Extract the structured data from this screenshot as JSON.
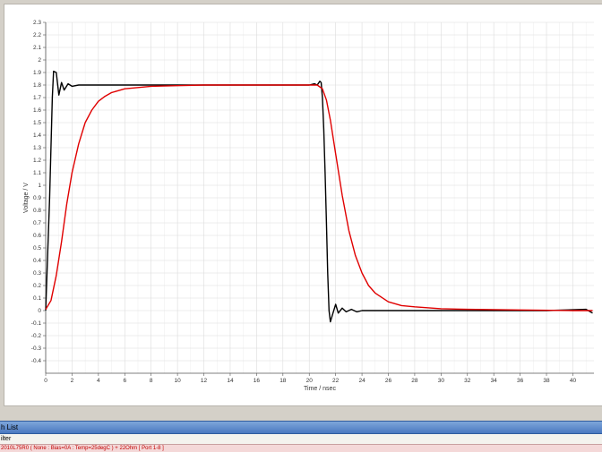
{
  "chart_data": {
    "type": "line",
    "xlabel": "Time / nsec",
    "ylabel": "Voltage / V",
    "xlim": [
      0,
      41.6
    ],
    "ylim": [
      -0.5,
      2.3
    ],
    "xticks": [
      0,
      2,
      4,
      6,
      8,
      10,
      12,
      14,
      16,
      18,
      20,
      22,
      24,
      26,
      28,
      30,
      32,
      34,
      36,
      38,
      40
    ],
    "yticks": [
      -0.4,
      -0.3,
      -0.2,
      -0.1,
      0,
      0.1,
      0.2,
      0.3,
      0.4,
      0.5,
      0.6,
      0.7,
      0.8,
      0.9,
      1,
      1.1,
      1.2,
      1.3,
      1.4,
      1.5,
      1.6,
      1.7,
      1.8,
      1.9,
      2,
      2.1,
      2.2,
      2.3
    ],
    "grid": true,
    "series": [
      {
        "color": "#000000",
        "x": [
          0,
          0.3,
          0.5,
          0.6,
          0.8,
          1.0,
          1.2,
          1.4,
          1.7,
          2.0,
          2.5,
          3,
          4,
          6,
          8,
          10,
          12,
          14,
          16,
          18,
          20,
          20.4,
          20.6,
          20.8,
          20.9,
          21.0,
          21.1,
          21.2,
          21.3,
          21.4,
          21.5,
          21.6,
          21.8,
          22.0,
          22.2,
          22.5,
          22.8,
          23.2,
          23.6,
          24,
          25,
          26,
          28,
          30,
          34,
          38,
          41,
          41.5
        ],
        "y": [
          0,
          0.9,
          1.7,
          1.91,
          1.9,
          1.72,
          1.82,
          1.76,
          1.81,
          1.79,
          1.8,
          1.8,
          1.8,
          1.8,
          1.8,
          1.8,
          1.8,
          1.8,
          1.8,
          1.8,
          1.8,
          1.81,
          1.8,
          1.83,
          1.82,
          1.7,
          1.45,
          1.1,
          0.7,
          0.3,
          0.0,
          -0.09,
          -0.02,
          0.05,
          -0.02,
          0.02,
          -0.01,
          0.01,
          -0.01,
          0.0,
          0.0,
          0.0,
          0.0,
          0.0,
          0.0,
          0.0,
          0.01,
          -0.02
        ]
      },
      {
        "color": "#e00000",
        "x": [
          0,
          0.4,
          0.8,
          1.2,
          1.6,
          2.0,
          2.5,
          3,
          3.5,
          4,
          4.5,
          5,
          6,
          7,
          8,
          10,
          12,
          16,
          20,
          20.6,
          21,
          21.3,
          21.6,
          22,
          22.5,
          23,
          23.5,
          24,
          24.5,
          25,
          26,
          27,
          28,
          30,
          32,
          36,
          40,
          41.5
        ],
        "y": [
          0.01,
          0.08,
          0.28,
          0.55,
          0.85,
          1.1,
          1.33,
          1.5,
          1.6,
          1.67,
          1.71,
          1.74,
          1.77,
          1.78,
          1.79,
          1.795,
          1.8,
          1.8,
          1.8,
          1.8,
          1.77,
          1.68,
          1.52,
          1.25,
          0.92,
          0.64,
          0.44,
          0.3,
          0.2,
          0.14,
          0.07,
          0.04,
          0.03,
          0.015,
          0.01,
          0.005,
          0.0,
          0.0
        ]
      }
    ]
  },
  "panel": {
    "title": "h List",
    "filter_label": "ilter",
    "selected_item": "2010L75R0 ( None : Bias=0A : Temp=25degC ) + 22Ohm [ Port 1-8 ]"
  }
}
